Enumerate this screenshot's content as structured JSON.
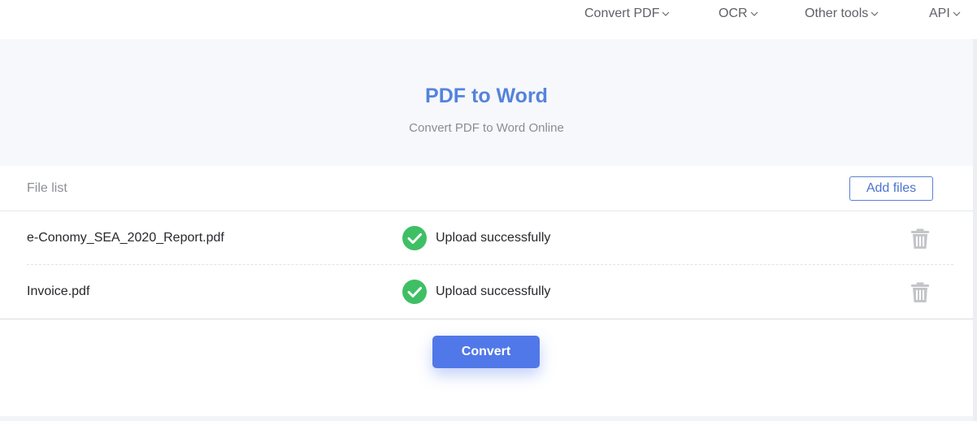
{
  "nav": {
    "items": [
      {
        "label": "Convert PDF"
      },
      {
        "label": "OCR"
      },
      {
        "label": "Other tools"
      },
      {
        "label": "API"
      }
    ]
  },
  "hero": {
    "title": "PDF to Word",
    "subtitle": "Convert PDF to Word Online"
  },
  "file_panel": {
    "header_label": "File list",
    "add_files_label": "Add files",
    "files": [
      {
        "name": "e-Conomy_SEA_2020_Report.pdf",
        "status": "Upload successfully"
      },
      {
        "name": "Invoice.pdf",
        "status": "Upload successfully"
      }
    ],
    "convert_label": "Convert"
  },
  "colors": {
    "accent": "#5583dc",
    "button": "#5178e8",
    "success": "#3fbf64",
    "trash": "#c4c5c8"
  }
}
